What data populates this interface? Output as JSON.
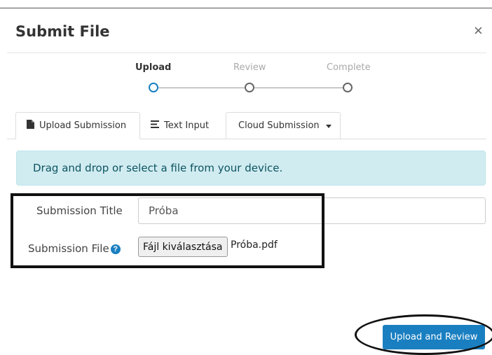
{
  "modal": {
    "title": "Submit File",
    "close_glyph": "×"
  },
  "steps": [
    {
      "label": "Upload",
      "active": true
    },
    {
      "label": "Review",
      "active": false
    },
    {
      "label": "Complete",
      "active": false
    }
  ],
  "tabs": [
    {
      "label": "Upload Submission",
      "icon": "file-icon",
      "active": true
    },
    {
      "label": "Text Input",
      "icon": "align-left-icon",
      "active": false
    },
    {
      "label": "Cloud Submission",
      "icon": "caret-down-icon",
      "active": false
    }
  ],
  "alert": {
    "text": "Drag and drop or select a file from your device."
  },
  "form": {
    "title_label": "Submission Title",
    "title_value": "Próba",
    "file_label": "Submission File",
    "file_button": "Fájl kiválasztása",
    "file_name": "Próba.pdf"
  },
  "actions": {
    "primary_label": "Upload and Review"
  },
  "colors": {
    "accent": "#1a7fc1",
    "alert_bg": "#d1ecf1",
    "alert_text": "#0c5460"
  }
}
